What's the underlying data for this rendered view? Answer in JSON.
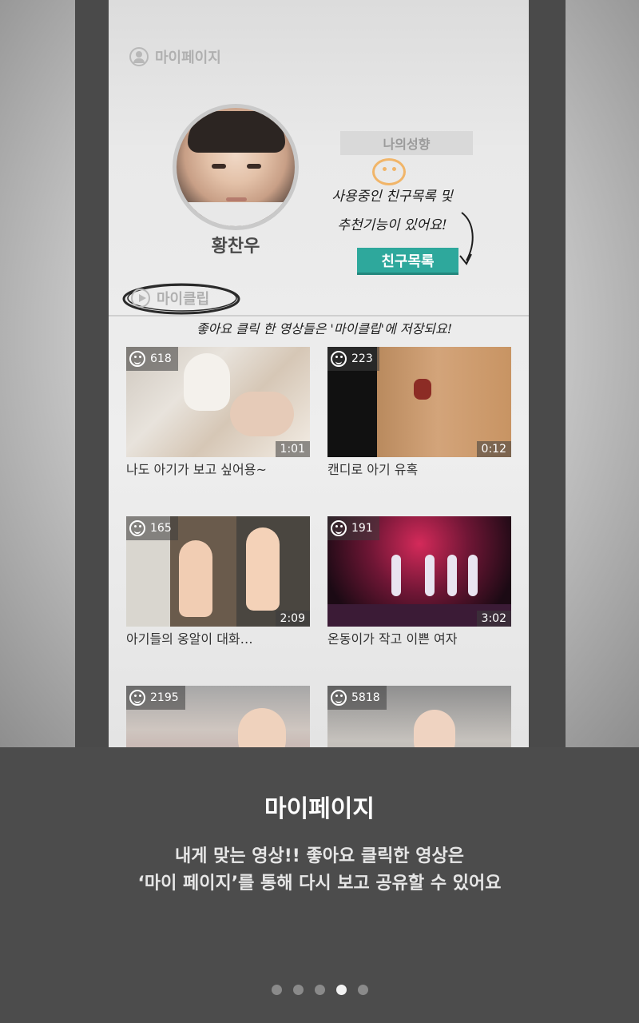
{
  "header": {
    "title": "마이페이지"
  },
  "profile": {
    "name": "황찬우"
  },
  "tendency": {
    "label": "나의성향",
    "dots": "•••"
  },
  "friends_button": {
    "label": "친구목록"
  },
  "annotations": {
    "friends_line1": "사용중인 친구목록 및",
    "friends_line2": "추천기능이 있어요!",
    "clip_note": "좋아요 클릭 한 영상들은 '마이클립'에 저장되요!"
  },
  "myclip": {
    "label": "마이클립"
  },
  "videos": [
    {
      "likes": "618",
      "duration": "1:01",
      "title": "나도 아기가 보고 싶어용~"
    },
    {
      "likes": "223",
      "duration": "0:12",
      "title": "캔디로 아기 유혹"
    },
    {
      "likes": "165",
      "duration": "2:09",
      "title": "아기들의 옹알이 대화…"
    },
    {
      "likes": "191",
      "duration": "3:02",
      "title": "온동이가 작고 이쁜 여자"
    },
    {
      "likes": "2195",
      "duration": "",
      "title": ""
    },
    {
      "likes": "5818",
      "duration": "",
      "title": ""
    }
  ],
  "panel": {
    "title": "마이페이지",
    "desc_line1": "내게 맞는 영상!! 좋아요 클릭한 영상은",
    "desc_line2": "‘마이 페이지’를 통해 다시 보고 공유할 수 있어요"
  },
  "pager": {
    "total": 5,
    "active_index": 3
  },
  "colors": {
    "accent": "#2ea89c",
    "panel_bg": "#4c4c4c",
    "emoticon": "#f3a94a"
  }
}
